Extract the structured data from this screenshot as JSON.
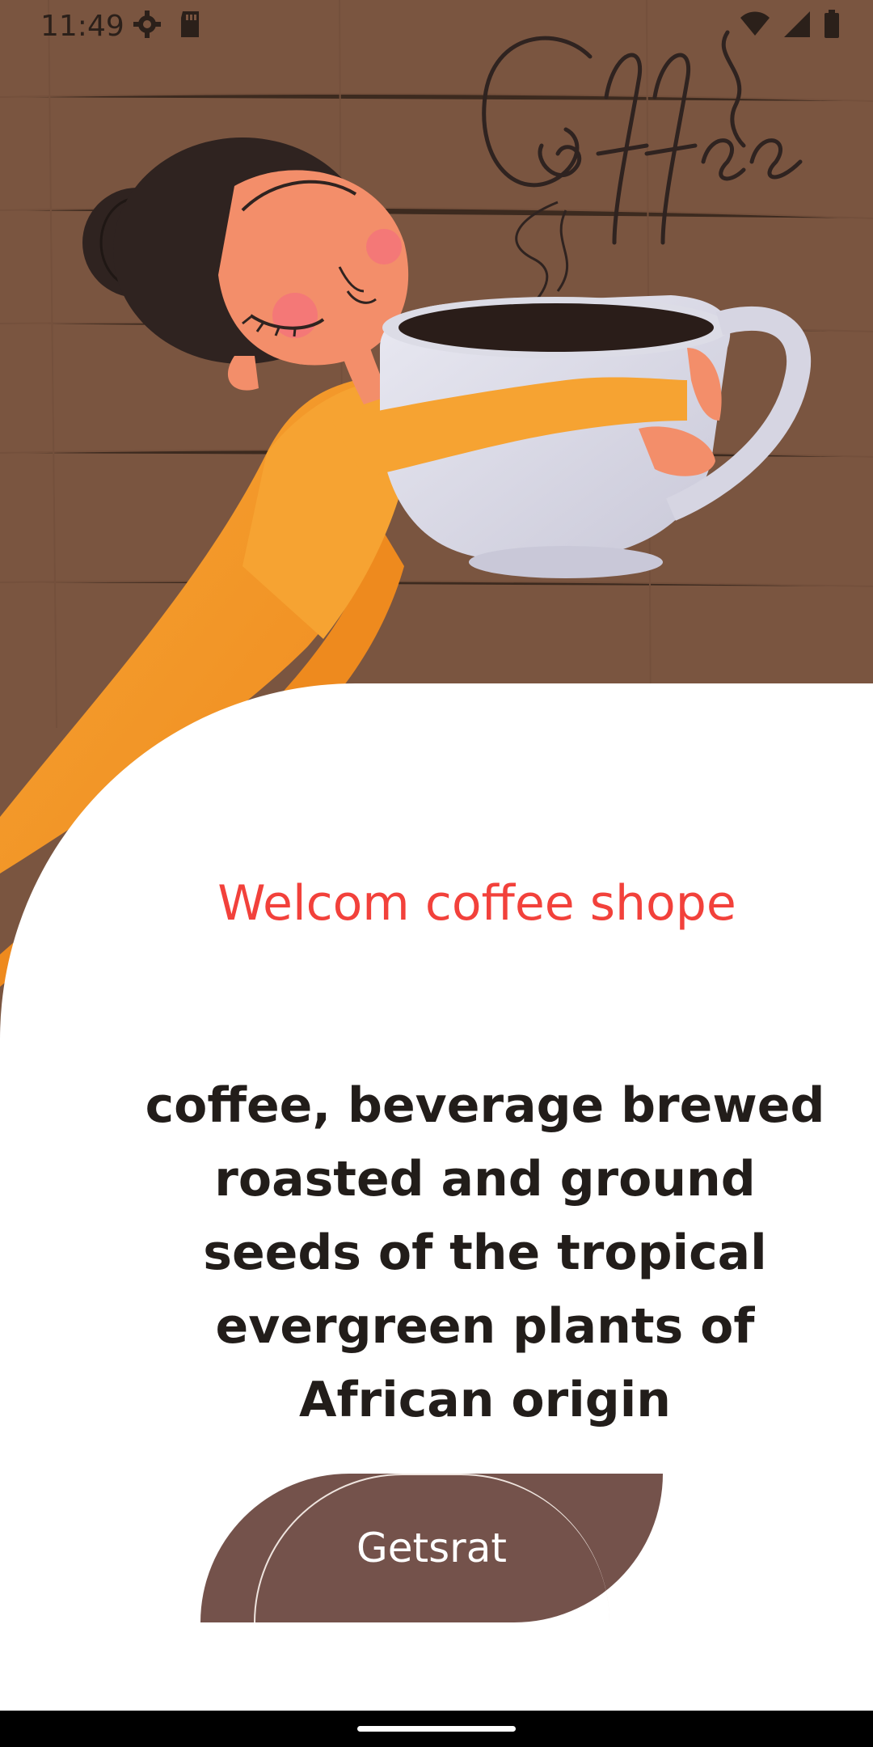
{
  "status_bar": {
    "time": "11:49",
    "left_icons": [
      "settings-gear-icon",
      "sd-card-icon"
    ],
    "right_icons": [
      "wifi-icon",
      "cell-signal-icon",
      "battery-icon"
    ]
  },
  "hero": {
    "illustration": "woman-hugging-coffee-cup",
    "script_lettering": "Coffee"
  },
  "welcome": {
    "title": "Welcom coffee shope",
    "description": "coffee, beverage brewed roasted and ground seeds of the tropical evergreen plants of African origin"
  },
  "cta": {
    "label": "Getsrat"
  },
  "colors": {
    "title": "#f2413b",
    "button": "#74524b",
    "background_brown": "#7a5540",
    "dress": "#f7a030"
  }
}
